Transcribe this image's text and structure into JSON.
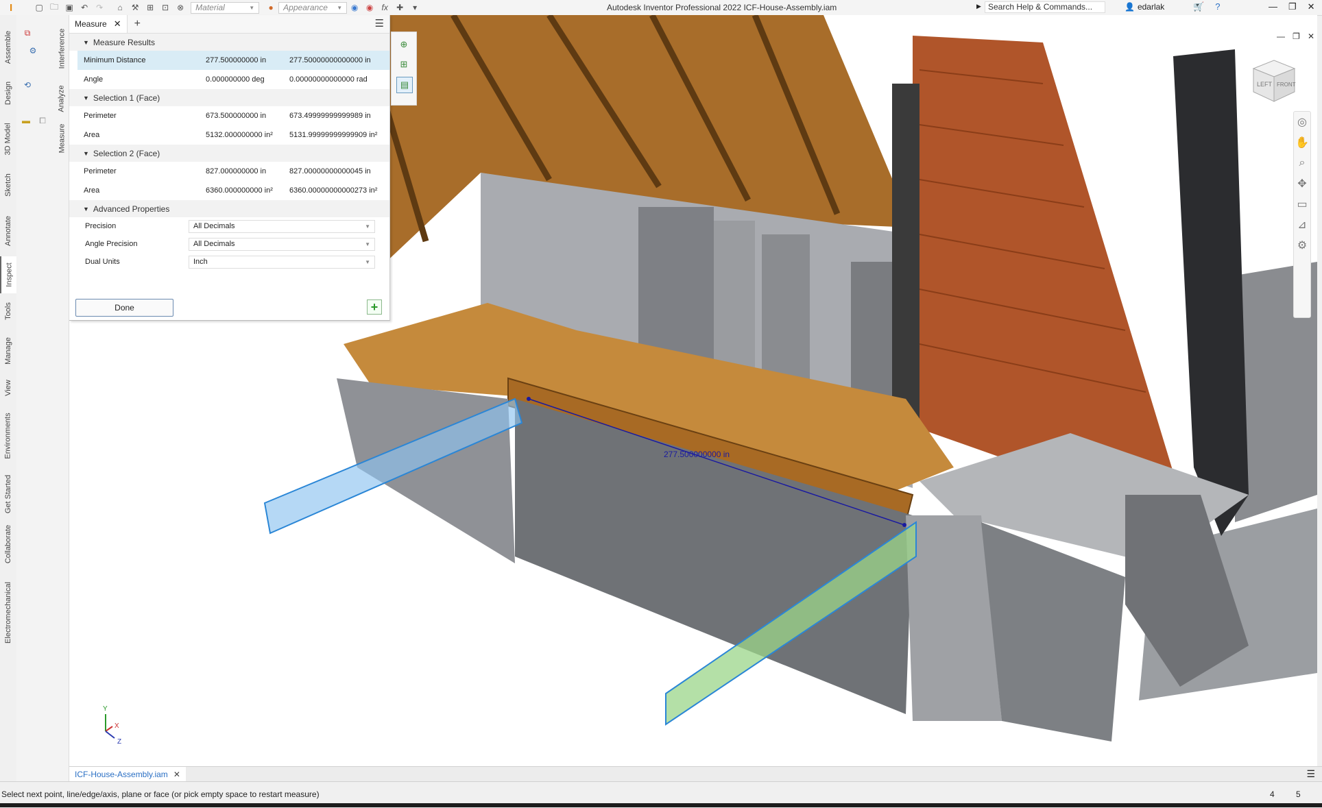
{
  "app": {
    "title": "Autodesk Inventor Professional 2022    ICF-House-Assembly.iam",
    "logo": "I",
    "material_placeholder": "Material",
    "appearance_placeholder": "Appearance",
    "search_placeholder": "Search Help & Commands...",
    "user": "edarlak"
  },
  "left_tabs": [
    "Assemble",
    "Design",
    "3D Model",
    "Sketch",
    "Annotate",
    "Inspect",
    "Tools",
    "Manage",
    "View",
    "Environments",
    "Get Started",
    "Collaborate",
    "Electromechanical"
  ],
  "active_left_tab": "Inspect",
  "inspect_panels": [
    "Interference",
    "Analyze",
    "Measure"
  ],
  "measure_panel": {
    "tab_label": "Measure",
    "results_header": "Measure Results",
    "results": [
      {
        "label": "Minimum Distance",
        "value": "277.500000000 in",
        "dual": "277.50000000000000 in"
      },
      {
        "label": "Angle",
        "value": "0.000000000 deg",
        "dual": "0.00000000000000 rad"
      }
    ],
    "selection1": {
      "header": "Selection 1 (Face)",
      "rows": [
        {
          "label": "Perimeter",
          "value": "673.500000000 in",
          "dual": "673.49999999999989 in"
        },
        {
          "label": "Area",
          "value": "5132.000000000 in²",
          "dual": "5131.99999999999909 in²"
        }
      ]
    },
    "selection2": {
      "header": "Selection 2 (Face)",
      "rows": [
        {
          "label": "Perimeter",
          "value": "827.000000000 in",
          "dual": "827.00000000000045 in"
        },
        {
          "label": "Area",
          "value": "6360.000000000 in²",
          "dual": "6360.00000000000273 in²"
        }
      ]
    },
    "advanced": {
      "header": "Advanced Properties",
      "rows": [
        {
          "label": "Precision",
          "value": "All Decimals"
        },
        {
          "label": "Angle Precision",
          "value": "All Decimals"
        },
        {
          "label": "Dual Units",
          "value": "Inch"
        }
      ]
    },
    "done_label": "Done"
  },
  "viewport": {
    "dimension_label": "277.500000000 in",
    "viewcube_left": "LEFT",
    "viewcube_front": "FRONT",
    "axis_labels": {
      "y": "Y",
      "x": "X",
      "z": "Z"
    },
    "colors": {
      "selection1": "#8ec3f0",
      "selection2": "#9bd68a",
      "dimension": "#1a1aa0"
    }
  },
  "document_tab": "ICF-House-Assembly.iam",
  "status": {
    "message": "Select next point, line/edge/axis, plane or face (or pick empty space to restart measure)",
    "count1": "4",
    "count2": "5"
  }
}
